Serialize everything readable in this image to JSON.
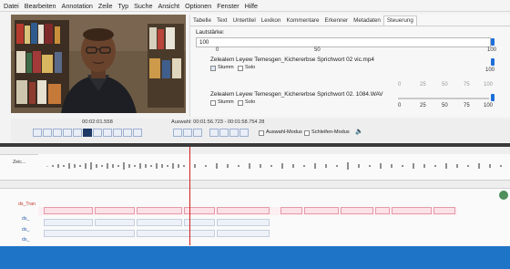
{
  "menu": [
    "Datei",
    "Bearbeiten",
    "Annotation",
    "Zeile",
    "Typ",
    "Suche",
    "Ansicht",
    "Optionen",
    "Fenster",
    "Hilfe"
  ],
  "tabs": [
    "Tabelle",
    "Text",
    "Untertitel",
    "Lexikon",
    "Kommentare",
    "Erkenner",
    "Metadaten",
    "Steuerung"
  ],
  "active_tab": "Steuerung",
  "volume": {
    "label": "Lautstärke:",
    "value": "100",
    "scale_top": [
      "0",
      "50",
      "100"
    ],
    "level_fraction": 1.0
  },
  "tracks": [
    {
      "title": "Zelealem Leyew Temesgen_Kichererbse Sprichwort 02 vic.mp4",
      "mute_label": "Stumm",
      "solo_label": "Solo",
      "scale": [
        "0",
        "25",
        "50",
        "75",
        "100"
      ],
      "end_value": "100",
      "scale_dimmed": true
    },
    {
      "title": "Zelealem Leyew Temesgen_Kichererbse Sprichwort 02. 1084.WAV",
      "mute_label": "Stumm",
      "solo_label": "Solo",
      "scale": [
        "0",
        "25",
        "50",
        "75",
        "100"
      ],
      "end_value": "",
      "scale_dimmed": false
    }
  ],
  "transport": {
    "time": "00:02:01.558",
    "selection": "Auswahl: 00:01:56.723 - 00:01:58.754 28",
    "select_mode": "Auswahl-Modus",
    "loop_mode": "Schleifen-Modus"
  },
  "timeline": {
    "tier_label_top": "Zeic...",
    "tier_label": "ds_Tran",
    "sub_tiers": [
      "ds_",
      "ds_",
      "ds_"
    ]
  },
  "colors": {
    "accent": "#1e6fd9",
    "footer": "#1e74c6",
    "crosshair": "#d11f1f",
    "annotation": "#fbe2e7"
  }
}
